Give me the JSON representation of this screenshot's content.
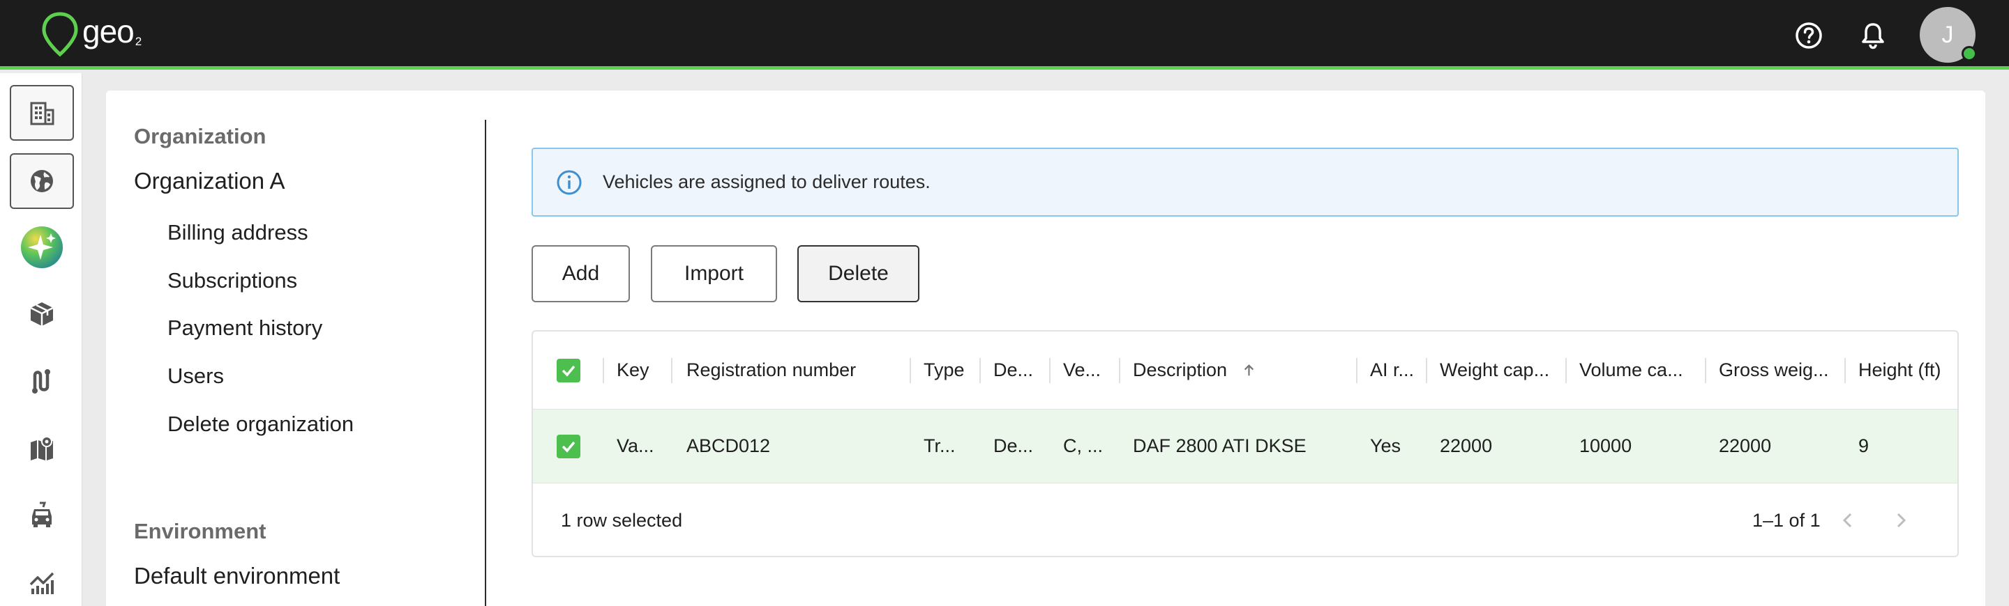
{
  "app": {
    "logo_text": "geo",
    "logo_sub": "2",
    "user_initial": "J",
    "accent_color": "#5ecf4f"
  },
  "topbar": {
    "help_icon": "help-circle-icon",
    "notifications_icon": "bell-icon"
  },
  "rail": {
    "items": [
      {
        "name": "organization-icon",
        "selected": true
      },
      {
        "name": "globe-icon",
        "selected": true
      },
      {
        "name": "ai-sparkle-icon",
        "selected": false
      },
      {
        "name": "package-icon",
        "selected": false
      },
      {
        "name": "route-icon",
        "selected": false
      },
      {
        "name": "map-icon",
        "selected": false
      },
      {
        "name": "vehicle-icon",
        "selected": false
      },
      {
        "name": "analytics-icon",
        "selected": false
      }
    ]
  },
  "org_nav": {
    "organization_heading": "Organization",
    "organization_name": "Organization A",
    "items": [
      "Billing address",
      "Subscriptions",
      "Payment history",
      "Users",
      "Delete organization"
    ],
    "environment_heading": "Environment",
    "environment_name": "Default environment"
  },
  "info_banner": {
    "text": "Vehicles are assigned to deliver routes."
  },
  "actions": {
    "add": "Add",
    "import": "Import",
    "delete": "Delete"
  },
  "table": {
    "columns": [
      "Key",
      "Registration number",
      "Type",
      "De...",
      "Ve...",
      "Description",
      "AI r...",
      "Weight cap...",
      "Volume ca...",
      "Gross weig...",
      "Height (ft)"
    ],
    "sorted_column": "Description",
    "sort_direction": "ascending",
    "rows": [
      {
        "selected": true,
        "cells": [
          "Va...",
          "ABCD012",
          "Tr...",
          "De...",
          "C, ...",
          "DAF 2800 ATI DKSE",
          "Yes",
          "22000",
          "10000",
          "22000",
          "9"
        ]
      }
    ],
    "selection_text": "1 row selected",
    "pagination_text": "1–1 of 1"
  }
}
